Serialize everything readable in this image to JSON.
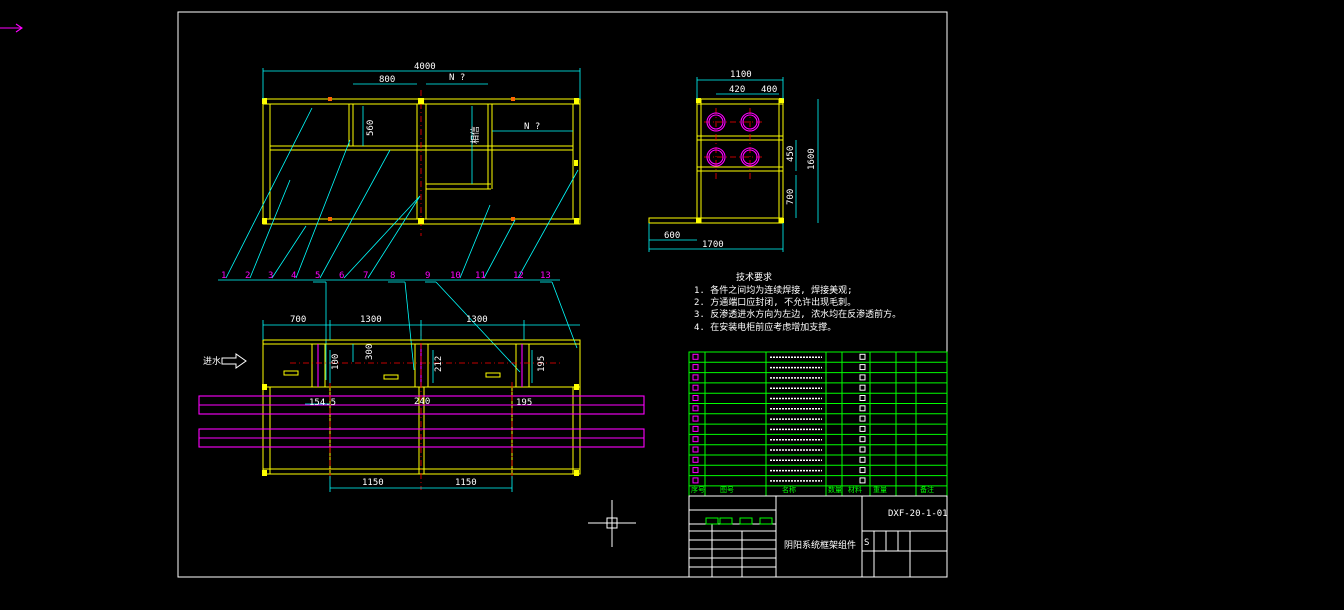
{
  "drawing": {
    "top_view_dims": {
      "overall": "4000",
      "span": "800",
      "unknown1": "N ?",
      "unknown2": "N ?",
      "height": "560",
      "inner": "相信"
    },
    "side_view_dims": {
      "width": "1100",
      "d1": "420",
      "d2": "400",
      "h1": "450",
      "h2": "700",
      "total_height": "1600",
      "base": "600",
      "overall_base": "1700"
    },
    "front_view_dims": {
      "a": "700",
      "b": "1300",
      "c": "1300",
      "h300": "300",
      "h100": "100",
      "h212": "212",
      "h195": "195",
      "w1": "154.5",
      "w2": "240",
      "w3": "195",
      "bottom1": "1150",
      "bottom2": "1150"
    },
    "inlet_label": "进水",
    "part_numbers": [
      "1",
      "2",
      "3",
      "4",
      "5",
      "6",
      "7",
      "8",
      "9",
      "10",
      "11",
      "12",
      "13"
    ],
    "tech_requirements": {
      "title": "技术要求",
      "items": [
        "1. 各件之间均为连续焊接, 焊接美观;",
        "2. 方通端口应封闭, 不允许出现毛刺。",
        "3. 反渗透进水方向为左边, 浓水均在反渗透前方。",
        "4. 在安装电柜前应考虑增加支撑。"
      ]
    },
    "title_block": {
      "drawing_number": "DXF-20-1-01",
      "drawing_name": "阴阳系统框架组件",
      "bom_header": [
        "序号",
        "图号",
        "名称",
        "数量",
        "材料",
        "重量",
        "备注"
      ],
      "stage_label": "S",
      "scale_letter": "S"
    }
  }
}
